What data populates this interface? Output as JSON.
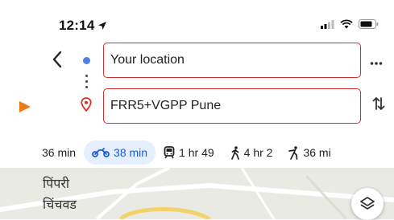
{
  "status_bar": {
    "time": "12:14"
  },
  "directions": {
    "origin_value": "Your location",
    "destination_value": "FRR5+VGPP Pune"
  },
  "modes": [
    {
      "label": "36 min",
      "icon": "car-icon"
    },
    {
      "label": "38 min",
      "icon": "motorbike-icon",
      "active": true
    },
    {
      "label": "1 hr 49",
      "icon": "transit-icon"
    },
    {
      "label": "4 hr 2",
      "icon": "walk-icon"
    },
    {
      "label": "36 mi",
      "icon": "ride-service-icon"
    }
  ],
  "map": {
    "label_line1": "पिंपरी",
    "label_line2": "चिंचवड"
  },
  "colors": {
    "accent": "#1a5bd6",
    "active_chip_bg": "#e6efff",
    "field_border": "#d32f2f",
    "origin_dot": "#4f7fe3",
    "pointer_arrow": "#ec7a16"
  }
}
